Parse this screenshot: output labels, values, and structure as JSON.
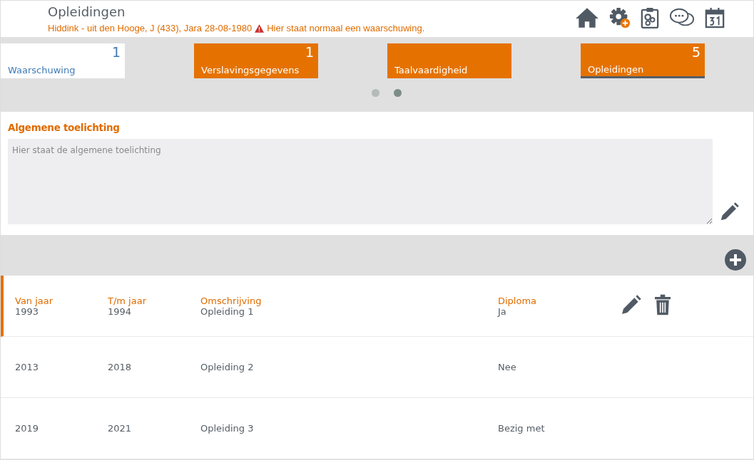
{
  "header": {
    "title": "Opleidingen",
    "client": "Hiddink - uit den Hooge, J (433), Jara 28-08-1980",
    "warning": "Hier staat normaal een waarschuwing."
  },
  "tiles": [
    {
      "kind": "warning",
      "label": "Waarschuwing",
      "count": "1",
      "selected": false
    },
    {
      "kind": "module",
      "label": "Verslavingsgegevens",
      "count": "1",
      "selected": false
    },
    {
      "kind": "module",
      "label": "Taalvaardigheid",
      "selected": false
    },
    {
      "kind": "module",
      "label": "Opleidingen",
      "count": "5",
      "selected": true
    }
  ],
  "pager": [
    {
      "selected": false
    },
    {
      "selected": true
    }
  ],
  "explanation": {
    "label": "Algemene toelichting",
    "placeholder": "Hier staat de algemene toelichting"
  },
  "table": {
    "columns": [
      "Van jaar",
      "T/m jaar",
      "Omschrijving",
      "Diploma"
    ],
    "rows": [
      {
        "cells": [
          "1993",
          "1994",
          "Opleiding 1",
          "Ja"
        ],
        "selected": true
      },
      {
        "cells": [
          "2013",
          "2018",
          "Opleiding 2",
          "Nee"
        ],
        "selected": false
      },
      {
        "cells": [
          "2019",
          "2021",
          "Opleiding 3",
          "Bezig met"
        ],
        "selected": false
      }
    ]
  }
}
